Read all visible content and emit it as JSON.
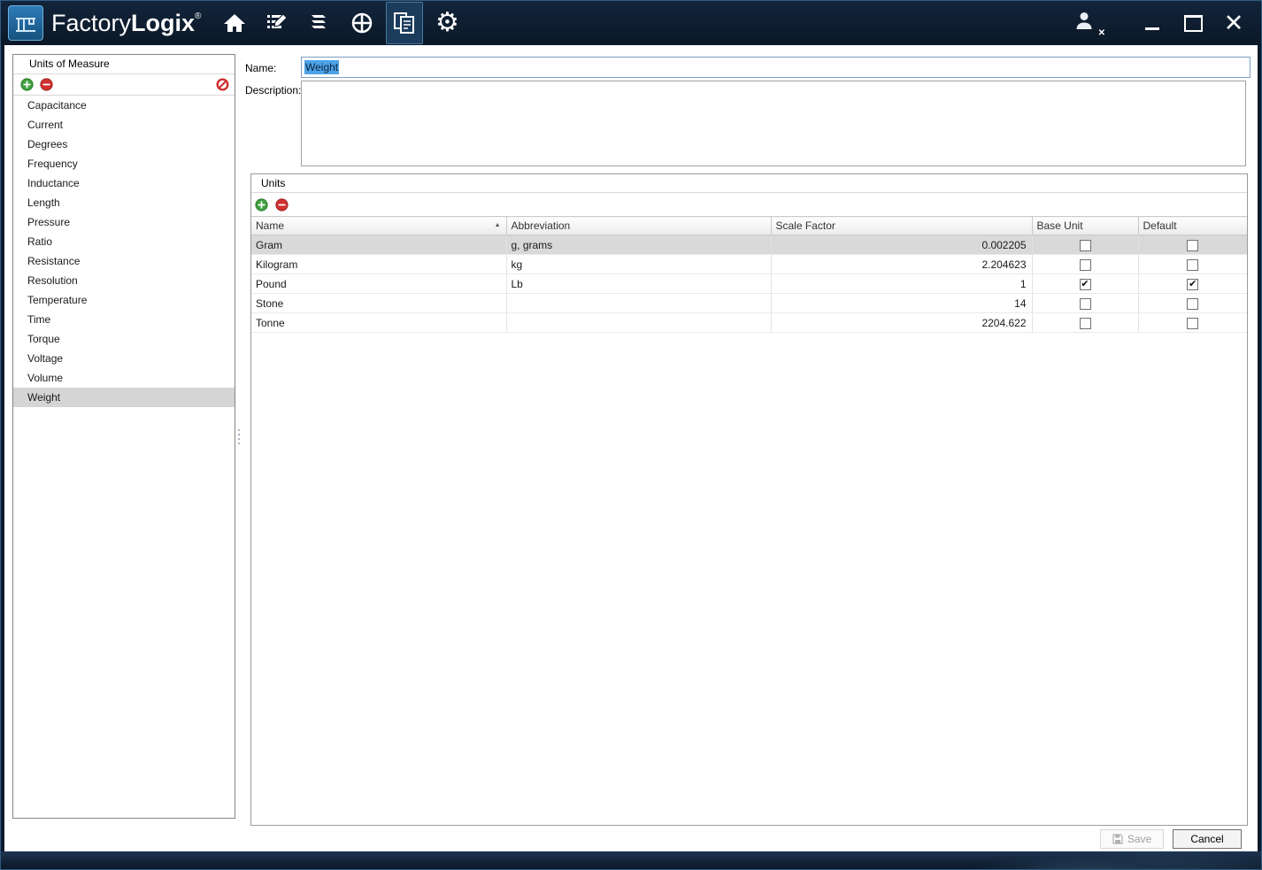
{
  "titlebar": {
    "app_name_light": "Factory",
    "app_name_bold": "Logix",
    "trademark": "®",
    "nav_icons": [
      "home",
      "process-editor",
      "materials",
      "production",
      "reports",
      "settings"
    ],
    "active_nav": "reports",
    "window_controls": [
      "user-logout",
      "minimize",
      "maximize",
      "close"
    ]
  },
  "sidebar": {
    "title": "Units of Measure",
    "toolbar_icons": [
      "add",
      "remove",
      "block"
    ],
    "items": [
      "Capacitance",
      "Current",
      "Degrees",
      "Frequency",
      "Inductance",
      "Length",
      "Pressure",
      "Ratio",
      "Resistance",
      "Resolution",
      "Temperature",
      "Time",
      "Torque",
      "Voltage",
      "Volume",
      "Weight"
    ],
    "selected": "Weight"
  },
  "form": {
    "name_label": "Name:",
    "name_value": "Weight",
    "description_label": "Description:",
    "description_value": ""
  },
  "units": {
    "group_title": "Units",
    "toolbar_icons": [
      "add",
      "remove"
    ],
    "columns": [
      "Name",
      "Abbreviation",
      "Scale Factor",
      "Base Unit",
      "Default"
    ],
    "sort_column": "Name",
    "sort_indicator": "▲",
    "selected_unit": "Gram",
    "rows": [
      {
        "name": "Gram",
        "abbreviation": "g, grams",
        "scale_factor": "0.002205",
        "base_unit": false,
        "default": false
      },
      {
        "name": "Kilogram",
        "abbreviation": "kg",
        "scale_factor": "2.204623",
        "base_unit": false,
        "default": false
      },
      {
        "name": "Pound",
        "abbreviation": "Lb",
        "scale_factor": "1",
        "base_unit": true,
        "default": true
      },
      {
        "name": "Stone",
        "abbreviation": "",
        "scale_factor": "14",
        "base_unit": false,
        "default": false
      },
      {
        "name": "Tonne",
        "abbreviation": "",
        "scale_factor": "2204.622",
        "base_unit": false,
        "default": false
      }
    ]
  },
  "footer": {
    "save_label": "Save",
    "save_enabled": false,
    "cancel_label": "Cancel"
  },
  "colors": {
    "titlebar_bg": "#0e1c2e",
    "active_nav_bg": "#1c3c5c",
    "selected_row": "#d9d9d9",
    "selection_highlight": "#4da3e8",
    "add_green": "#3fa13f",
    "remove_red": "#cf3030"
  }
}
